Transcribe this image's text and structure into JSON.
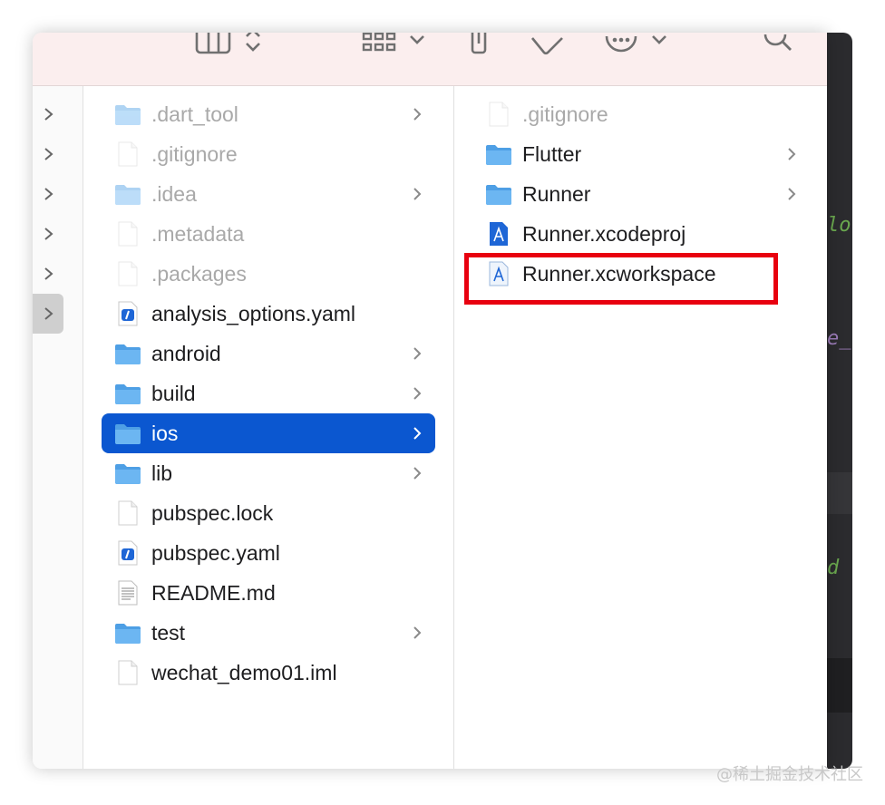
{
  "window": {
    "toolbar": {
      "icons": [
        "columns-view-icon",
        "view-switch-icon",
        "group-grid-icon",
        "group-dropdown-icon",
        "share-icon",
        "tag-icon",
        "more-actions-icon",
        "more-dropdown-icon",
        "search-icon"
      ]
    },
    "column_root": {
      "items": [
        {
          "state": "collapsed"
        },
        {
          "state": "collapsed"
        },
        {
          "state": "collapsed"
        },
        {
          "state": "collapsed"
        },
        {
          "state": "collapsed"
        },
        {
          "state": "selected"
        }
      ]
    },
    "column_project": {
      "items": [
        {
          "label": ".dart_tool",
          "icon": "folder-icon",
          "has_children": true,
          "hidden": true
        },
        {
          "label": ".gitignore",
          "icon": "file-icon",
          "has_children": false,
          "hidden": true
        },
        {
          "label": ".idea",
          "icon": "folder-icon",
          "has_children": true,
          "hidden": true
        },
        {
          "label": ".metadata",
          "icon": "file-icon",
          "has_children": false,
          "hidden": true
        },
        {
          "label": ".packages",
          "icon": "file-icon",
          "has_children": false,
          "hidden": true
        },
        {
          "label": "analysis_options.yaml",
          "icon": "yaml-file-icon",
          "has_children": false,
          "hidden": false
        },
        {
          "label": "android",
          "icon": "folder-icon",
          "has_children": true,
          "hidden": false
        },
        {
          "label": "build",
          "icon": "folder-icon",
          "has_children": true,
          "hidden": false
        },
        {
          "label": "ios",
          "icon": "folder-icon",
          "has_children": true,
          "hidden": false,
          "selected": true
        },
        {
          "label": "lib",
          "icon": "folder-icon",
          "has_children": true,
          "hidden": false
        },
        {
          "label": "pubspec.lock",
          "icon": "file-icon",
          "has_children": false,
          "hidden": false
        },
        {
          "label": "pubspec.yaml",
          "icon": "yaml-file-icon",
          "has_children": false,
          "hidden": false
        },
        {
          "label": "README.md",
          "icon": "text-document-icon",
          "has_children": false,
          "hidden": false
        },
        {
          "label": "test",
          "icon": "folder-icon",
          "has_children": true,
          "hidden": false
        },
        {
          "label": "wechat_demo01.iml",
          "icon": "file-icon",
          "has_children": false,
          "hidden": false
        }
      ]
    },
    "column_ios": {
      "items": [
        {
          "label": ".gitignore",
          "icon": "file-icon",
          "has_children": false,
          "hidden": true
        },
        {
          "label": "Flutter",
          "icon": "folder-icon",
          "has_children": true,
          "hidden": false
        },
        {
          "label": "Runner",
          "icon": "folder-icon",
          "has_children": true,
          "hidden": false
        },
        {
          "label": "Runner.xcodeproj",
          "icon": "xcodeproj-icon",
          "has_children": false,
          "hidden": false
        },
        {
          "label": "Runner.xcworkspace",
          "icon": "xcworkspace-icon",
          "has_children": false,
          "hidden": false,
          "highlighted": true
        }
      ]
    }
  },
  "annotation": {
    "color": "#e8000f",
    "target": "Runner.xcworkspace"
  },
  "colors": {
    "selection": "#0b57d0",
    "folder": "#5aa8e8",
    "toolbar_bg": "#fbeeee"
  },
  "watermark": "@稀土掘金技术社区"
}
